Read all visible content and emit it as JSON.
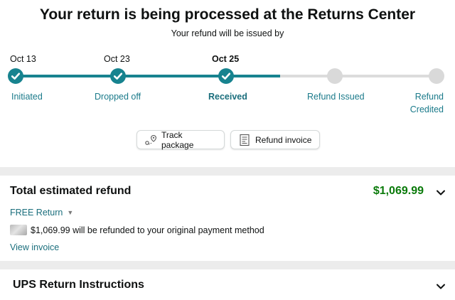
{
  "header": {
    "title": "Your return is being processed at the Returns Center",
    "subtitle": "Your refund will be issued by"
  },
  "progress": {
    "accent_color": "#17838f",
    "pending_color": "#d9d9d9",
    "completed_fraction": 0.64,
    "steps": [
      {
        "date": "Oct 13",
        "label": "Initiated",
        "status": "done"
      },
      {
        "date": "Oct 23",
        "label": "Dropped off",
        "status": "done"
      },
      {
        "date": "Oct 25",
        "label": "Received",
        "status": "done"
      },
      {
        "date": "",
        "label": "Refund Issued",
        "status": "pending"
      },
      {
        "date": "",
        "label_line1": "Refund",
        "label_line2": "Credited",
        "status": "pending"
      }
    ]
  },
  "actions": {
    "track_package": "Track package",
    "refund_invoice": "Refund invoice"
  },
  "refund": {
    "title": "Total estimated refund",
    "amount": "$1,069.99",
    "amount_color": "#0a7a0a",
    "free_return": "FREE Return",
    "payment_line": "$1,069.99 will be refunded to your original payment method",
    "view_invoice": "View invoice"
  },
  "ups": {
    "title": "UPS Return Instructions"
  }
}
